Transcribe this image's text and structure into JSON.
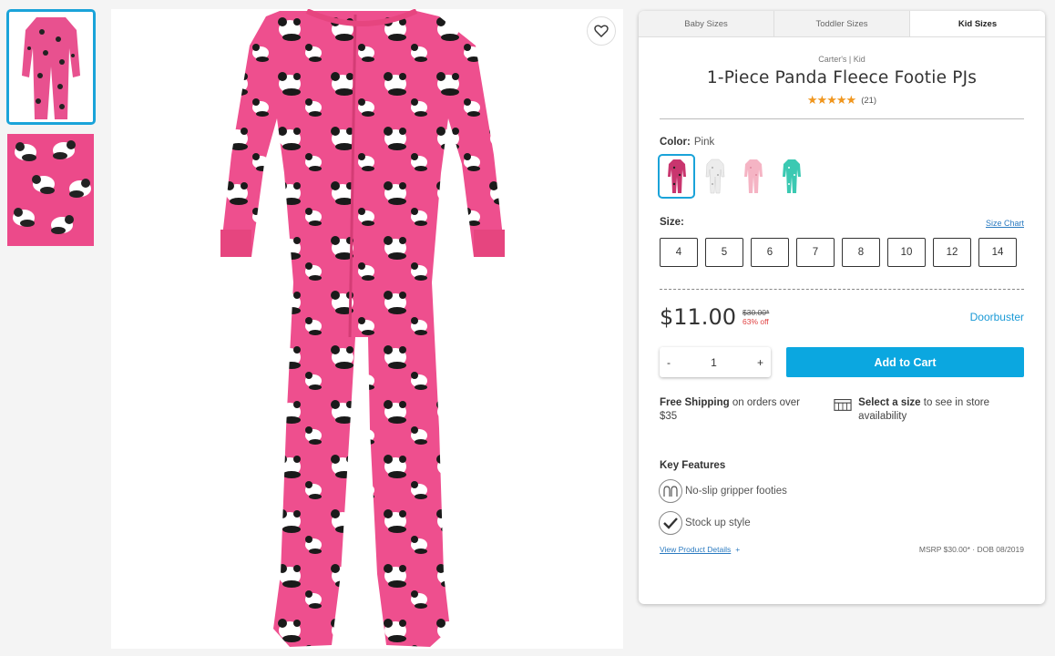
{
  "tabs": [
    {
      "label": "Baby Sizes"
    },
    {
      "label": "Toddler Sizes"
    },
    {
      "label": "Kid Sizes"
    }
  ],
  "product": {
    "brand": "Carter's | Kid",
    "title": "1-Piece Panda Fleece Footie PJs",
    "stars": "★★★★★",
    "rating_count": "(21)"
  },
  "color": {
    "label": "Color:",
    "value": "Pink",
    "swatches": [
      {
        "name": "Pink Panda",
        "fill": "#e8518f"
      },
      {
        "name": "White",
        "fill": "#efefef"
      },
      {
        "name": "Light Pink",
        "fill": "#f5b4c4"
      },
      {
        "name": "Teal",
        "fill": "#3bc9b2"
      }
    ]
  },
  "size": {
    "label": "Size:",
    "chart_link": "Size Chart",
    "options": [
      "4",
      "5",
      "6",
      "7",
      "8",
      "10",
      "12",
      "14"
    ]
  },
  "price": {
    "current": "$11.00",
    "original": "$30.00*",
    "discount": "63% off",
    "promo": "Doorbuster"
  },
  "cart": {
    "minus": "-",
    "qty": "1",
    "plus": "+",
    "add_label": "Add to Cart"
  },
  "shipping": {
    "free_bold": "Free Shipping",
    "free_rest": " on orders over $35",
    "store_bold": "Select a size",
    "store_rest": " to see in store availability"
  },
  "features": {
    "title": "Key Features",
    "items": [
      {
        "icon": "gripper-icon",
        "label": "No-slip gripper footies"
      },
      {
        "icon": "checkmark-icon",
        "label": "Stock up style"
      }
    ]
  },
  "footer": {
    "details_link": "View Product Details",
    "plus": "+",
    "msrp": "MSRP $30.00* · DOB 08/2019"
  },
  "colors": {
    "accent": "#1aa3d9",
    "button": "#0ba7e0",
    "star": "#f0961e",
    "discount": "#e04040",
    "pajama": "#e8518f"
  }
}
